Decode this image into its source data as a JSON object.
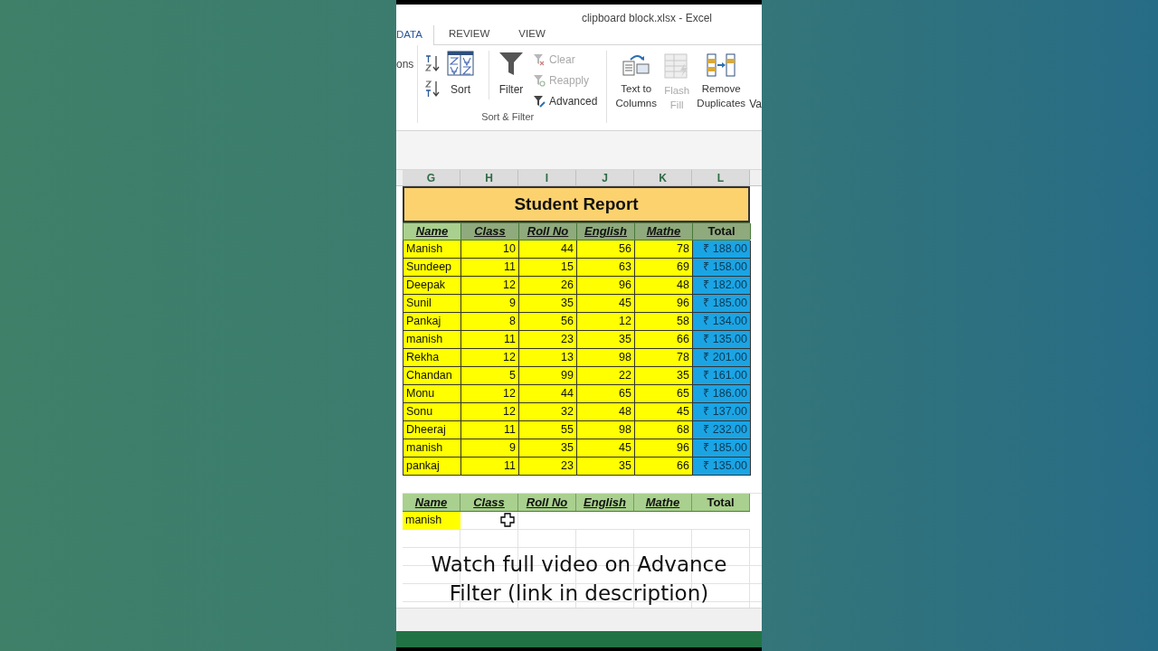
{
  "window": {
    "title": "clipboard block.xlsx - Excel"
  },
  "ribbon_tabs": [
    {
      "label": "DATA",
      "selected": true
    },
    {
      "label": "REVIEW",
      "selected": false
    },
    {
      "label": "VIEW",
      "selected": false
    }
  ],
  "ribbon": {
    "cut_left": "ons",
    "sort_label": "Sort",
    "filter_label": "Filter",
    "filter_buttons": [
      {
        "label": "Clear",
        "disabled": true,
        "kind": "clear"
      },
      {
        "label": "Reapply",
        "disabled": true,
        "kind": "reapply"
      },
      {
        "label": "Advanced",
        "disabled": false,
        "kind": "advanced"
      }
    ],
    "group_label": "Sort & Filter",
    "data_tools": [
      {
        "label": "Text to Columns",
        "disabled": false,
        "kind": "text-to-columns"
      },
      {
        "label": "Flash Fill",
        "disabled": true,
        "kind": "flash-fill"
      },
      {
        "label": "Remove Duplicates",
        "disabled": false,
        "kind": "remove-duplicates"
      }
    ],
    "cut_right": "Va"
  },
  "sheet": {
    "columns": [
      "G",
      "H",
      "I",
      "J",
      "K",
      "L"
    ],
    "report_title": "Student Report",
    "headers": [
      {
        "text": "Name",
        "underlined": true,
        "selected": false
      },
      {
        "text": "Class",
        "underlined": true,
        "selected": true
      },
      {
        "text": "Roll No",
        "underlined": true,
        "selected": true
      },
      {
        "text": "English",
        "underlined": true,
        "selected": true
      },
      {
        "text": "Mathe",
        "underlined": true,
        "selected": true
      },
      {
        "text": "Total",
        "underlined": false,
        "selected": true
      }
    ],
    "rows": [
      [
        "Manish",
        "10",
        "44",
        "56",
        "78",
        "₹ 188.00"
      ],
      [
        "Sundeep",
        "11",
        "15",
        "63",
        "69",
        "₹ 158.00"
      ],
      [
        "Deepak",
        "12",
        "26",
        "96",
        "48",
        "₹ 182.00"
      ],
      [
        "Sunil",
        "9",
        "35",
        "45",
        "96",
        "₹ 185.00"
      ],
      [
        "Pankaj",
        "8",
        "56",
        "12",
        "58",
        "₹ 134.00"
      ],
      [
        "manish",
        "11",
        "23",
        "35",
        "66",
        "₹ 135.00"
      ],
      [
        "Rekha",
        "12",
        "13",
        "98",
        "78",
        "₹ 201.00"
      ],
      [
        "Chandan",
        "5",
        "99",
        "22",
        "35",
        "₹ 161.00"
      ],
      [
        "Monu",
        "12",
        "44",
        "65",
        "65",
        "₹ 186.00"
      ],
      [
        "Sonu",
        "12",
        "32",
        "48",
        "45",
        "₹ 137.00"
      ],
      [
        "Dheeraj",
        "11",
        "55",
        "98",
        "68",
        "₹ 232.00"
      ],
      [
        "manish",
        "9",
        "35",
        "45",
        "96",
        "₹ 185.00"
      ],
      [
        "pankaj",
        "11",
        "23",
        "35",
        "66",
        "₹ 135.00"
      ]
    ],
    "criteria_headers": [
      {
        "text": "Name",
        "underlined": true
      },
      {
        "text": "Class",
        "underlined": true
      },
      {
        "text": "Roll No",
        "underlined": true
      },
      {
        "text": "English",
        "underlined": true
      },
      {
        "text": "Mathe",
        "underlined": true
      },
      {
        "text": "Total",
        "underlined": false
      }
    ],
    "criteria_value": "manish"
  },
  "caption": "Watch full video on Advance Filter (link in description)"
}
